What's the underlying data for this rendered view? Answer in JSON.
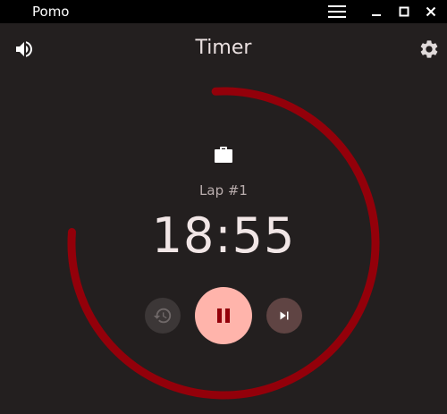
{
  "window": {
    "app_name": "Pomo"
  },
  "header": {
    "title": "Timer"
  },
  "timer": {
    "lap_label": "Lap #1",
    "time": "18:55",
    "progress_fraction": 0.77
  },
  "icons": {
    "volume": "volume-icon",
    "settings": "gear-icon",
    "briefcase": "briefcase-icon",
    "reset": "history-icon",
    "pause": "pause-icon",
    "skip": "skip-next-icon",
    "menu": "hamburger-icon",
    "minimize": "minimize-icon",
    "maximize": "maximize-icon",
    "close": "close-icon"
  },
  "colors": {
    "background": "#231f1f",
    "accent_ring": "#93000a",
    "pause_button": "#ffb4ab",
    "skip_button": "#5f4443",
    "reset_button": "#3c3737"
  }
}
